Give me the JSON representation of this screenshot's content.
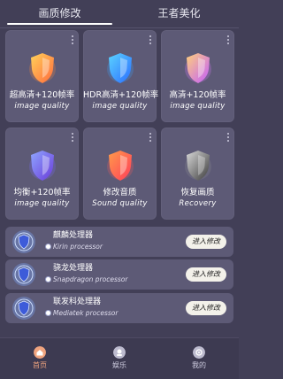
{
  "tabs": [
    {
      "label": "画质修改",
      "active": true
    },
    {
      "label": "王者美化",
      "active": false
    }
  ],
  "cards": [
    {
      "title": "超高清+120帧率",
      "subtitle": "image quality",
      "icon": "shield-orange-icon",
      "colors": [
        "#ffd25a",
        "#ff6a3d"
      ]
    },
    {
      "title": "HDR高清+120帧率",
      "subtitle": "image quality",
      "icon": "shield-blue-icon",
      "colors": [
        "#5bd3ff",
        "#2b6dff"
      ]
    },
    {
      "title": "高清+120帧率",
      "subtitle": "image quality",
      "icon": "shield-pink-icon",
      "colors": [
        "#ffd07a",
        "#c35cff"
      ]
    },
    {
      "title": "均衡+120帧率",
      "subtitle": "image quality",
      "icon": "shield-purple-icon",
      "colors": [
        "#8fa6ff",
        "#6a3bd9"
      ]
    },
    {
      "title": "修改音质",
      "subtitle": "Sound quality",
      "icon": "shield-red-icon",
      "colors": [
        "#ff9b4a",
        "#ff3d5a"
      ]
    },
    {
      "title": "恢复画质",
      "subtitle": "Recovery",
      "icon": "shield-gray-icon",
      "colors": [
        "#d9d9d9",
        "#3a3a3a"
      ]
    }
  ],
  "processors": [
    {
      "name": "麒麟处理器",
      "name_en": "Kirin processor",
      "action": "进入修改"
    },
    {
      "name": "骁龙处理器",
      "name_en": "Snapdragon processor",
      "action": "进入修改"
    },
    {
      "name": "联发科处理器",
      "name_en": "Mediatek processor",
      "action": "进入修改"
    }
  ],
  "nav": [
    {
      "label": "首页",
      "icon": "home-icon",
      "active": true
    },
    {
      "label": "娱乐",
      "icon": "entertainment-icon",
      "active": false
    },
    {
      "label": "我的",
      "icon": "profile-icon",
      "active": false
    }
  ],
  "colors": {
    "background": "#423f57",
    "card": "#5d5a76",
    "active_nav": "#f0a47f"
  }
}
